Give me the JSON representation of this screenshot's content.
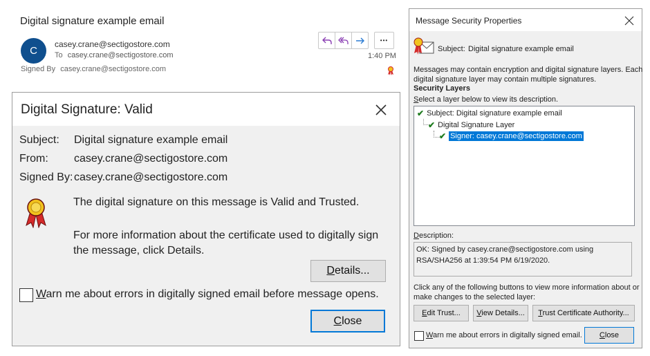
{
  "email": {
    "subject": "Digital signature example email",
    "avatar_initial": "C",
    "sender": "casey.crane@sectigostore.com",
    "to_label": "To",
    "to": "casey.crane@sectigostore.com",
    "signed_by_label": "Signed By",
    "signed_by": "casey.crane@sectigostore.com",
    "time": "1:40 PM",
    "more_label": "•••",
    "accent_color": "#0f4f8e"
  },
  "sig_dialog": {
    "title": "Digital Signature: Valid",
    "subject_label": "Subject:",
    "subject": "Digital signature example email",
    "from_label": "From:",
    "from": "casey.crane@sectigostore.com",
    "signed_by_label": "Signed By:",
    "signed_by": "casey.crane@sectigostore.com",
    "message": "The digital signature on this message is Valid and Trusted.",
    "info": "For more information about the certificate used to digitally sign the message, click Details.",
    "details_label_ul": "D",
    "details_label_rest": "etails...",
    "warn_ul": "W",
    "warn_rest": "arn me about errors in digitally signed email before message opens.",
    "close_ul": "C",
    "close_rest": "lose",
    "warn_checked": false
  },
  "security_dialog": {
    "title": "Message Security Properties",
    "subject_label": "Subject:",
    "subject": "Digital signature example email",
    "intro_line1": "Messages may contain encryption and digital signature layers. Each",
    "intro_line2": "digital signature layer may contain multiple signatures.",
    "layers_heading": "Security Layers",
    "select_ul": "S",
    "select_rest": "elect a layer below to view its description.",
    "tree": [
      "Subject: Digital signature example email",
      "Digital Signature Layer",
      "Signer: casey.crane@sectigostore.com"
    ],
    "description_ul": "D",
    "description_rest": "escription:",
    "description": "OK: Signed by casey.crane@sectigostore.com using RSA/SHA256 at 1:39:54 PM 6/19/2020.",
    "buttons_intro_line1": "Click any of the following buttons to view more information about or",
    "buttons_intro_line2": "make changes to the selected layer:",
    "edit_trust_ul": "E",
    "edit_trust_rest": "dit Trust...",
    "view_details_ul": "V",
    "view_details_rest": "iew Details...",
    "trust_ca_ul": "T",
    "trust_ca_rest": "rust Certificate Authority...",
    "warn_ul": "W",
    "warn_rest": "arn me about errors in digitally signed email.",
    "close_ul": "C",
    "close_rest": "lose",
    "warn_checked": false
  },
  "icons": {
    "reply": "reply-icon",
    "reply_all": "reply-all-icon",
    "forward": "forward-icon",
    "signature_ribbon": "signature-ribbon-icon",
    "close": "close-icon"
  }
}
